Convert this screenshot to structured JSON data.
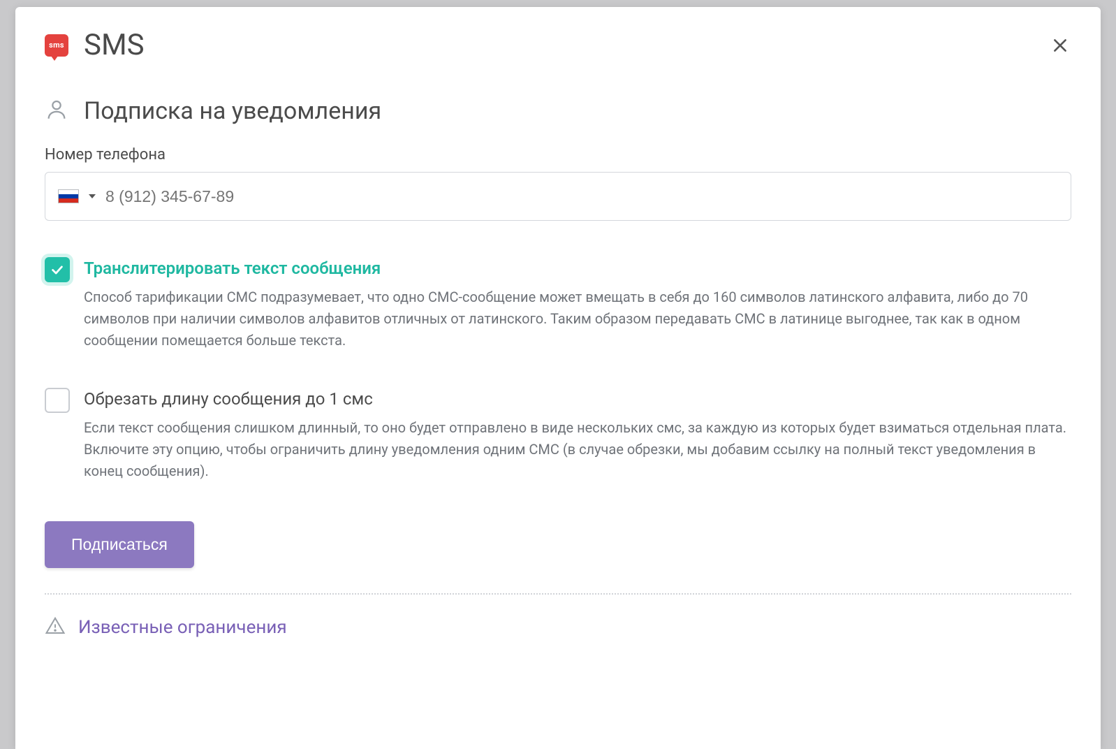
{
  "header": {
    "icon_label": "sms",
    "title": "SMS"
  },
  "section": {
    "title": "Подписка на уведомления"
  },
  "phone": {
    "label": "Номер телефона",
    "placeholder": "8 (912) 345-67-89",
    "value": "",
    "country": "RU"
  },
  "options": {
    "transliterate": {
      "checked": true,
      "title": "Транслитерировать текст сообщения",
      "description": "Способ тарификации СМС подразумевает, что одно СМС-сообщение может вмещать в себя до 160 символов латинского алфавита, либо до 70 символов при наличии символов алфавитов отличных от латинского. Таким образом передавать СМС в латинице выгоднее, так как в одном сообщении помещается больше текста."
    },
    "truncate": {
      "checked": false,
      "title": "Обрезать длину сообщения до 1 смс",
      "description": "Если текст сообщения слишком длинный, то оно будет отправлено в виде нескольких смс, за каждую из которых будет взиматься отдельная плата. Включите эту опцию, чтобы ограничить длину уведомления одним СМС (в случае обрезки, мы добавим ссылку на полный текст уведомления в конец сообщения)."
    }
  },
  "actions": {
    "subscribe": "Подписаться"
  },
  "footer": {
    "known_limitations": "Известные ограничения"
  },
  "colors": {
    "accent_teal": "#1fb8a1",
    "accent_purple": "#8c79c0",
    "link_purple": "#7960b6",
    "danger_red": "#e4423e"
  }
}
